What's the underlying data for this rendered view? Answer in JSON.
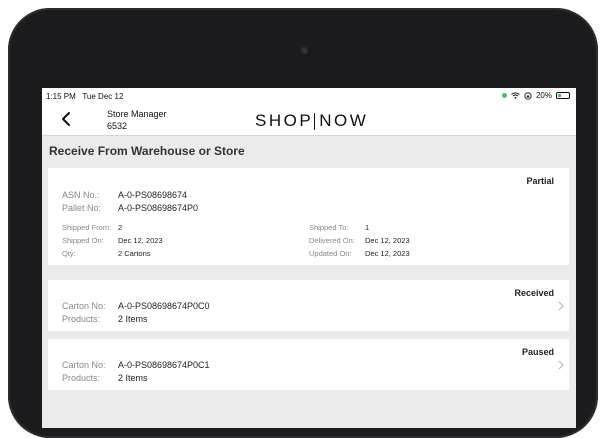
{
  "status_bar": {
    "time": "1:15 PM",
    "date": "Tue Dec 12",
    "battery": "20%"
  },
  "header": {
    "store_title": "Store Manager",
    "store_number": "6532",
    "brand_left": "SHOP",
    "brand_right": "NOW"
  },
  "page_title": "Receive From Warehouse or Store",
  "asn_card": {
    "status": "Partial",
    "asn_label": "ASN No.:",
    "asn_value": "A-0-PS08698674",
    "pallet_label": "Pallet No:",
    "pallet_value": "A-0-PS08698674P0",
    "shipped_from_label": "Shipped From:",
    "shipped_from_value": "2",
    "shipped_to_label": "Shipped To:",
    "shipped_to_value": "1",
    "shipped_on_label": "Shipped On:",
    "shipped_on_value": "Dec 12, 2023",
    "delivered_on_label": "Delivered On:",
    "delivered_on_value": "Dec 12, 2023",
    "qty_label": "Qty:",
    "qty_value": "2 Cartons",
    "updated_on_label": "Updated On:",
    "updated_on_value": "Dec 12, 2023"
  },
  "cartons": [
    {
      "status": "Received",
      "carton_label": "Carton No:",
      "carton_value": "A-0-PS08698674P0C0",
      "products_label": "Products:",
      "products_value": "2 Items"
    },
    {
      "status": "Paused",
      "carton_label": "Carton No:",
      "carton_value": "A-0-PS08698674P0C1",
      "products_label": "Products:",
      "products_value": "2 Items"
    }
  ],
  "colors": {
    "screen_bg": "#ebebeb",
    "device_frame": "#1c1c1e",
    "status_green": "#34c759"
  },
  "icons": {
    "back": "chevron-left-icon",
    "row_arrow": "chevron-right-icon",
    "wifi": "wifi-icon",
    "battery": "battery-icon"
  }
}
